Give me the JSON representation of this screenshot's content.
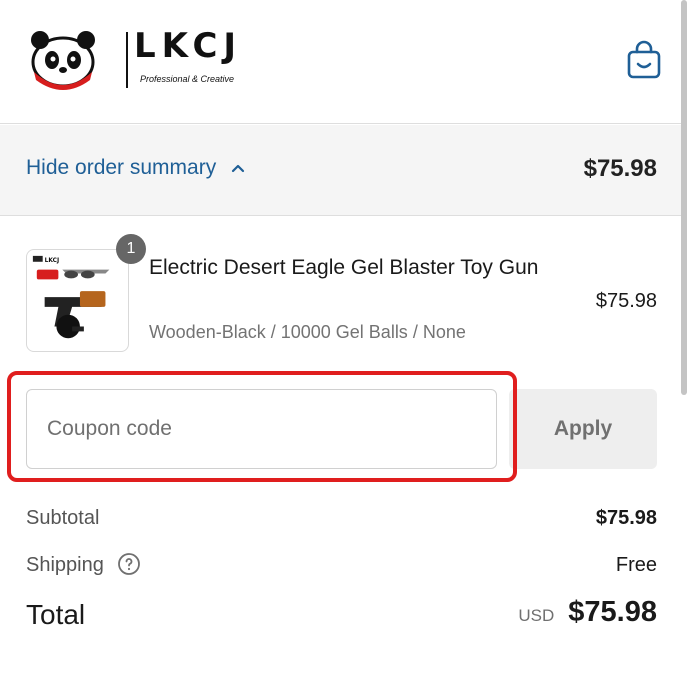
{
  "header": {
    "brand": "LKCJ",
    "tagline": "Professional & Creative",
    "cart_icon": "shopping-bag-icon"
  },
  "summary": {
    "toggle_label": "Hide order summary",
    "toggle_icon": "chevron-up-icon",
    "total": "$75.98"
  },
  "line_items": [
    {
      "quantity": "1",
      "name": "Electric Desert Eagle Gel Blaster Toy Gun",
      "variant": "Wooden-Black / 10000 Gel Balls / None",
      "price": "$75.98"
    }
  ],
  "coupon": {
    "placeholder": "Coupon code",
    "value": "",
    "apply_label": "Apply"
  },
  "totals": {
    "subtotal_label": "Subtotal",
    "subtotal_value": "$75.98",
    "shipping_label": "Shipping",
    "shipping_value": "Free",
    "total_label": "Total",
    "currency": "USD",
    "total_value": "$75.98"
  },
  "colors": {
    "link": "#1f5f96",
    "highlight": "#e01e1e",
    "summary_bg": "#f5f5f5"
  }
}
